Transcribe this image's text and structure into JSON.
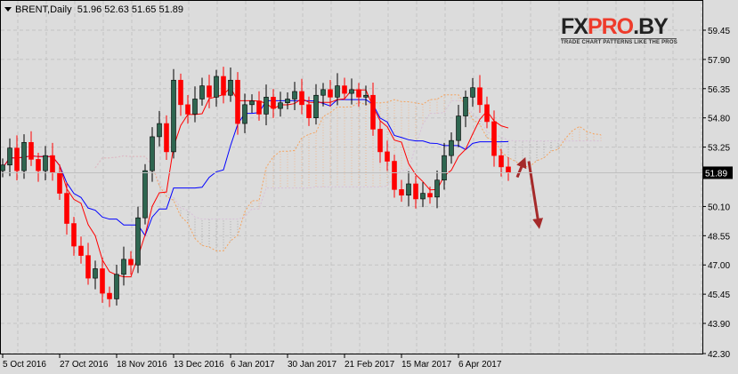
{
  "header": {
    "symbol": "BRENT,Daily",
    "ohlc": "51.96 52.63 51.65 51.89"
  },
  "logo": {
    "text_dark": "FX",
    "text_red": "PRO",
    "text_dark2": ".BY",
    "tagline": "TRADE CHART PATTERNS LIKE THE PROS"
  },
  "colors": {
    "background": "#dcdcdc",
    "grid": "#c4c4c4",
    "bull": "#2e6650",
    "bear": "#ff0000",
    "tenkan": "#ff0000",
    "kijun": "#0000ff",
    "span_a": "#f4a460",
    "span_b": "#d8bfd8",
    "arrow": "#a52a2a",
    "current_price_bg": "#000000"
  },
  "chart_data": {
    "type": "candlestick",
    "title": "BRENT,Daily",
    "indicator": "Ichimoku Kinko Hyo",
    "ylim": [
      42.3,
      59.45
    ],
    "y_ticks": [
      "59.45",
      "57.90",
      "56.35",
      "54.80",
      "53.25",
      "50.10",
      "48.55",
      "47.00",
      "45.45",
      "43.90",
      "42.30"
    ],
    "current_price": "51.89",
    "x_ticks": [
      "5 Oct 2016",
      "27 Oct 2016",
      "18 Nov 2016",
      "13 Dec 2016",
      "6 Jan 2017",
      "30 Jan 2017",
      "21 Feb 2017",
      "15 Mar 2017",
      "6 Apr 2017"
    ],
    "x_tick_bar_index": [
      0,
      8,
      16,
      24,
      32,
      40,
      48,
      56,
      64
    ],
    "grid": true,
    "closes": [
      52.3,
      53.2,
      52.0,
      53.5,
      52.6,
      52.0,
      52.8,
      51.9,
      50.8,
      49.2,
      48.0,
      47.5,
      46.3,
      46.8,
      45.5,
      45.2,
      46.5,
      47.3,
      47.0,
      49.5,
      52.0,
      53.8,
      54.5,
      53.0,
      56.8,
      55.5,
      55.0,
      55.8,
      56.5,
      55.9,
      57.0,
      56.0,
      56.8,
      54.5,
      55.5,
      55.7,
      55.0,
      55.9,
      55.3,
      55.6,
      55.8,
      56.2,
      55.5,
      54.8,
      56.0,
      56.3,
      55.9,
      56.5,
      56.1,
      56.3,
      55.9,
      56.0,
      54.2,
      53.0,
      52.5,
      51.0,
      50.7,
      51.3,
      50.5,
      50.8,
      50.6,
      51.5,
      52.8,
      53.6,
      54.9,
      55.9,
      56.4,
      55.5,
      54.6,
      52.8,
      52.2,
      51.89
    ],
    "first_open": 52.0,
    "annotations": [
      {
        "type": "arrow",
        "direction": "up",
        "from_price": 51.65,
        "to_price": 52.6
      },
      {
        "type": "arrow",
        "direction": "down",
        "from_price": 52.5,
        "to_price": 48.9
      }
    ]
  }
}
